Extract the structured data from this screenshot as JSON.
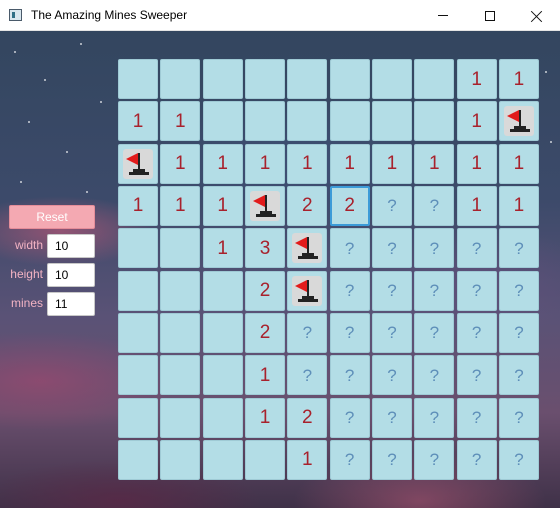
{
  "window": {
    "title": "The Amazing Mines Sweeper"
  },
  "controls": {
    "reset_label": "Reset",
    "width_label": "width",
    "width_value": "10",
    "height_label": "height",
    "height_value": "10",
    "mines_label": "mines",
    "mines_value": "11"
  },
  "board": {
    "columns": 10,
    "rows": 10,
    "focused_cell": [
      3,
      5
    ],
    "colors": {
      "cell_background": "#b3dde6",
      "number": "#a8212c",
      "unknown": "#5e8fb9",
      "flag": "#e21b1b",
      "focus_border": "#3c9bd8"
    },
    "cells": [
      [
        "",
        "",
        "",
        "",
        "",
        "",
        "",
        "",
        "1",
        "1"
      ],
      [
        "1",
        "1",
        "",
        "",
        "",
        "",
        "",
        "",
        "1",
        "F"
      ],
      [
        "F",
        "1",
        "1",
        "1",
        "1",
        "1",
        "1",
        "1",
        "1",
        "1"
      ],
      [
        "1",
        "1",
        "1",
        "F",
        "2",
        "2",
        "?",
        "?",
        "1",
        "1"
      ],
      [
        "",
        "",
        "1",
        "3",
        "F",
        "?",
        "?",
        "?",
        "?",
        "?"
      ],
      [
        "",
        "",
        "",
        "2",
        "F",
        "?",
        "?",
        "?",
        "?",
        "?"
      ],
      [
        "",
        "",
        "",
        "2",
        "?",
        "?",
        "?",
        "?",
        "?",
        "?"
      ],
      [
        "",
        "",
        "",
        "1",
        "?",
        "?",
        "?",
        "?",
        "?",
        "?"
      ],
      [
        "",
        "",
        "",
        "1",
        "2",
        "?",
        "?",
        "?",
        "?",
        "?"
      ],
      [
        "",
        "",
        "",
        "",
        "1",
        "?",
        "?",
        "?",
        "?",
        "?"
      ]
    ]
  }
}
